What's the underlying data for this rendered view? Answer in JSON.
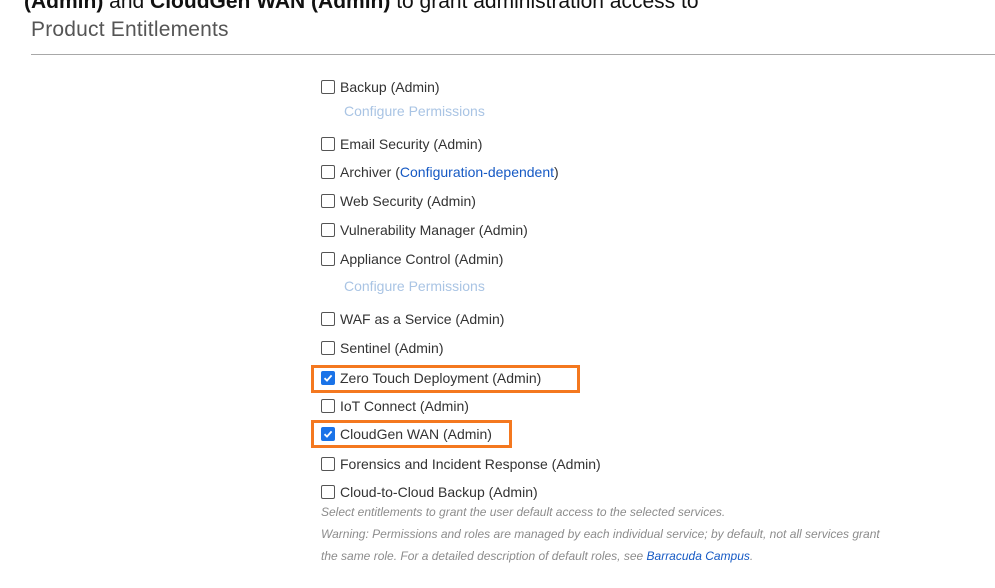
{
  "top_text": {
    "part1": "(Admin)",
    "part2": " and ",
    "part3": "CloudGen WAN (Admin)",
    "part4": " to grant administration access to"
  },
  "section_title": "Product Entitlements",
  "entitlements": [
    {
      "label": "Backup (Admin)",
      "checked": false,
      "configure": "Configure Permissions"
    },
    {
      "label": "Email Security (Admin)",
      "checked": false
    },
    {
      "label_prefix": "Archiver (",
      "label_link": "Configuration-dependent",
      "label_suffix": ")",
      "checked": false
    },
    {
      "label": "Web Security (Admin)",
      "checked": false
    },
    {
      "label": "Vulnerability Manager (Admin)",
      "checked": false
    },
    {
      "label": "Appliance Control (Admin)",
      "checked": false,
      "configure": "Configure Permissions"
    },
    {
      "label": "WAF as a Service (Admin)",
      "checked": false
    },
    {
      "label": "Sentinel (Admin)",
      "checked": false
    },
    {
      "label": "Zero Touch Deployment (Admin)",
      "checked": true,
      "highlighted": true
    },
    {
      "label": "IoT Connect (Admin)",
      "checked": false
    },
    {
      "label": "CloudGen WAN (Admin)",
      "checked": true,
      "highlighted": true
    },
    {
      "label": "Forensics and Incident Response (Admin)",
      "checked": false
    },
    {
      "label": "Cloud-to-Cloud Backup (Admin)",
      "checked": false
    }
  ],
  "help": {
    "line1": "Select entitlements to grant the user default access to the selected services.",
    "line2": "Warning: Permissions and roles are managed by each individual service; by default, not all services grant",
    "line3_prefix": "the same role. For a detailed description of default roles, see ",
    "line3_link": "Barracuda Campus",
    "line3_suffix": "."
  },
  "colors": {
    "checkbox_checked": "#1a73e8",
    "highlight_border": "#f4781f",
    "link": "#1559c4",
    "configure_link": "#a9c4e4"
  }
}
